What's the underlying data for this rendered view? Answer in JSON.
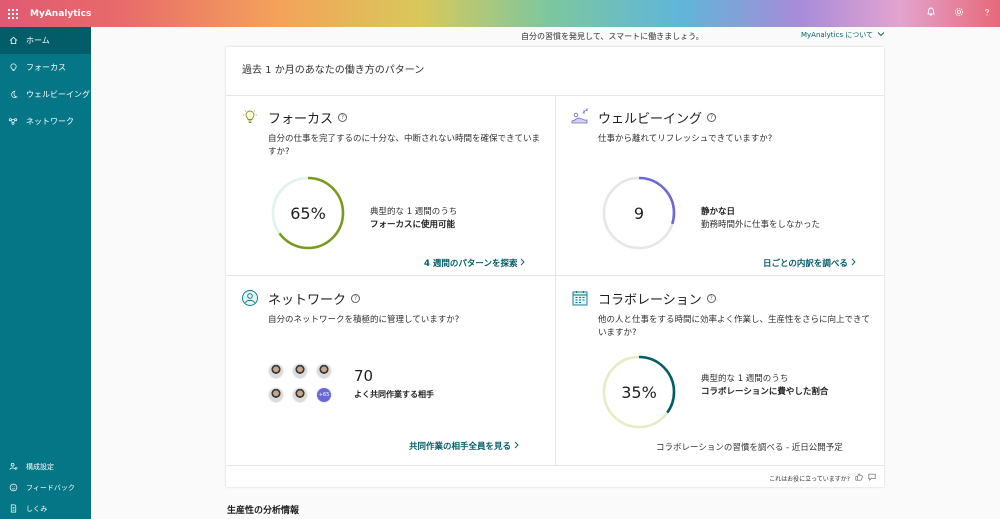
{
  "app": {
    "title": "MyAnalytics"
  },
  "sidebar": {
    "items": [
      {
        "label": "ホーム",
        "icon": "home-icon",
        "active": true
      },
      {
        "label": "フォーカス",
        "icon": "lightbulb-icon"
      },
      {
        "label": "ウェルビーイング",
        "icon": "moon-icon"
      },
      {
        "label": "ネットワーク",
        "icon": "network-icon"
      }
    ],
    "bottom": [
      {
        "label": "構成設定",
        "icon": "settings-person-icon"
      },
      {
        "label": "フィードバック",
        "icon": "feedback-icon"
      },
      {
        "label": "しくみ",
        "icon": "document-icon"
      }
    ]
  },
  "header": {
    "tagline": "自分の習慣を発見して、スマートに働きましょう。",
    "about_link": "MyAnalytics について"
  },
  "panel": {
    "title": "過去 1 か月のあなたの働き方のパターン",
    "focus": {
      "title": "フォーカス",
      "question": "自分の仕事を完了するのに十分な、中断されない時間を確保できていますか?",
      "value": "65%",
      "progress": 0.65,
      "sub": "典型的な 1 週間のうち",
      "main": "フォーカスに使用可能",
      "link": "4 週間のパターンを探索"
    },
    "wellbeing": {
      "title": "ウェルビーイング",
      "question": "仕事から離れてリフレッシュできていますか?",
      "value": "9",
      "progress": 0.3,
      "main": "静かな日",
      "sub": "勤務時間外に仕事をしなかった",
      "link": "日ごとの内訳を調べる"
    },
    "network": {
      "title": "ネットワーク",
      "question": "自分のネットワークを積極的に管理していますか?",
      "value": "70",
      "main": "よく共同作業する相手",
      "more_badge": "+65",
      "link": "共同作業の相手全員を見る"
    },
    "collaboration": {
      "title": "コラボレーション",
      "question": "他の人と仕事をする時間に効率よく作業し、生産性をさらに向上できていますか?",
      "value": "35%",
      "progress": 0.35,
      "sub": "典型的な 1 週間のうち",
      "main": "コラボレーションに費やした割合",
      "note": "コラボレーションの習慣を調べる - 近日公開予定"
    },
    "feedback_text": "これはお役に立っていますか?"
  },
  "section_heading": "生産性の分析情報",
  "colors": {
    "sidebar": "#047685",
    "sidebar_active": "#035d69",
    "focus_ring": "#7a9a1f",
    "wellbeing_ring": "#6b69d6",
    "collab_ring": "#035d69",
    "track": "#e6e6e6"
  }
}
